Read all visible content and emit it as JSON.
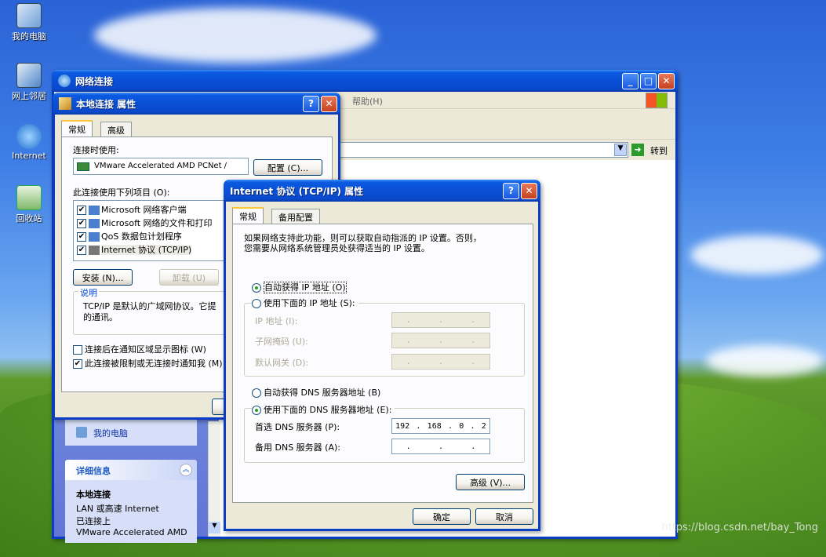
{
  "desktop": {
    "icons": [
      {
        "label": "我的电脑"
      },
      {
        "label": "网上邻居"
      },
      {
        "label": "Internet"
      },
      {
        "label": "回收站"
      }
    ]
  },
  "network_window": {
    "title": "网络连接",
    "menu_partial": "帮助(H)",
    "go_button": "转到",
    "sidebar": {
      "my_computer_link": "我的电脑",
      "details_header": "详细信息",
      "details_title": "本地连接",
      "details_line1": "LAN 或高速 Internet",
      "details_line2": "已连接上",
      "details_line3": "VMware Accelerated AMD"
    }
  },
  "props_window": {
    "title": "本地连接 属性",
    "tabs": [
      "常规",
      "高级"
    ],
    "connect_using_label": "连接时使用:",
    "adapter_name": "VMware Accelerated AMD PCNet /",
    "configure_button": "配置 (C)...",
    "items_label": "此连接使用下列项目 (O):",
    "items": [
      {
        "label": "Microsoft 网络客户端",
        "checked": true
      },
      {
        "label": "Microsoft 网络的文件和打印",
        "checked": true
      },
      {
        "label": "QoS 数据包计划程序",
        "checked": true
      },
      {
        "label": "Internet 协议 (TCP/IP)",
        "checked": true
      }
    ],
    "install_button": "安装 (N)...",
    "uninstall_button": "卸载 (U)",
    "description_header": "说明",
    "description_text1": "TCP/IP 是默认的广域网协议。它提",
    "description_text2": "的通讯。",
    "show_icon_label": "连接后在通知区域显示图标 (W)",
    "show_icon_checked": false,
    "notify_label": "此连接被限制或无连接时通知我 (M)",
    "notify_checked": true
  },
  "tcpip_window": {
    "title": "Internet 协议 (TCP/IP) 属性",
    "tabs": [
      "常规",
      "备用配置"
    ],
    "intro_line1": "如果网络支持此功能，则可以获取自动指派的 IP 设置。否则，",
    "intro_line2": "您需要从网络系统管理员处获得适当的 IP 设置。",
    "auto_ip_label": "自动获得 IP 地址 (O)",
    "manual_ip_label": "使用下面的 IP 地址 (S):",
    "ip_label": "IP 地址 (I):",
    "subnet_label": "子网掩码 (U):",
    "gateway_label": "默认网关 (D):",
    "auto_dns_label": "自动获得 DNS 服务器地址 (B)",
    "manual_dns_label": "使用下面的 DNS 服务器地址 (E):",
    "preferred_dns_label": "首选 DNS 服务器 (P):",
    "alternate_dns_label": "备用 DNS 服务器 (A):",
    "preferred_dns": [
      "192",
      "168",
      "0",
      "2"
    ],
    "advanced_button": "高级 (V)...",
    "ok_button": "确定",
    "cancel_button": "取消",
    "ip_mode": "auto",
    "dns_mode": "manual"
  },
  "watermark": "https://blog.csdn.net/bay_Tong"
}
